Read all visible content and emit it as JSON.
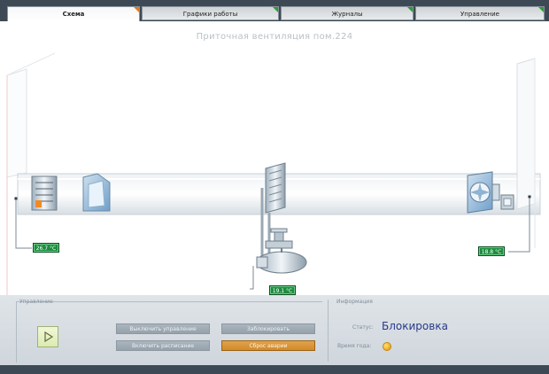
{
  "tabs": [
    {
      "label": "Схема",
      "active": true
    },
    {
      "label": "Графики работы",
      "active": false
    },
    {
      "label": "Журналы",
      "active": false
    },
    {
      "label": "Управление",
      "active": false
    }
  ],
  "title": "Приточная вентиляция пом.224",
  "temperatures": {
    "outdoor": "26.7 °C",
    "heater": "19.1 °C",
    "supply": "18.8 °C"
  },
  "control": {
    "title": "Управление",
    "btn_off_control": "Выключить управление",
    "btn_off_schedule": "Включить расписание",
    "btn_lock": "Заблокировать",
    "btn_reset_alarm": "Сброс аварии"
  },
  "info": {
    "title": "Информация",
    "status_label": "Статус:",
    "status_value": "Блокировка",
    "season_label": "Время года:"
  },
  "colors": {
    "accent_active_tab": "#e37a1f",
    "tab_marker": "#2d9a3a",
    "temp_badge": "#1d8c3f",
    "status_text": "#2a3a8c",
    "reset_button": "#d08a2c"
  }
}
